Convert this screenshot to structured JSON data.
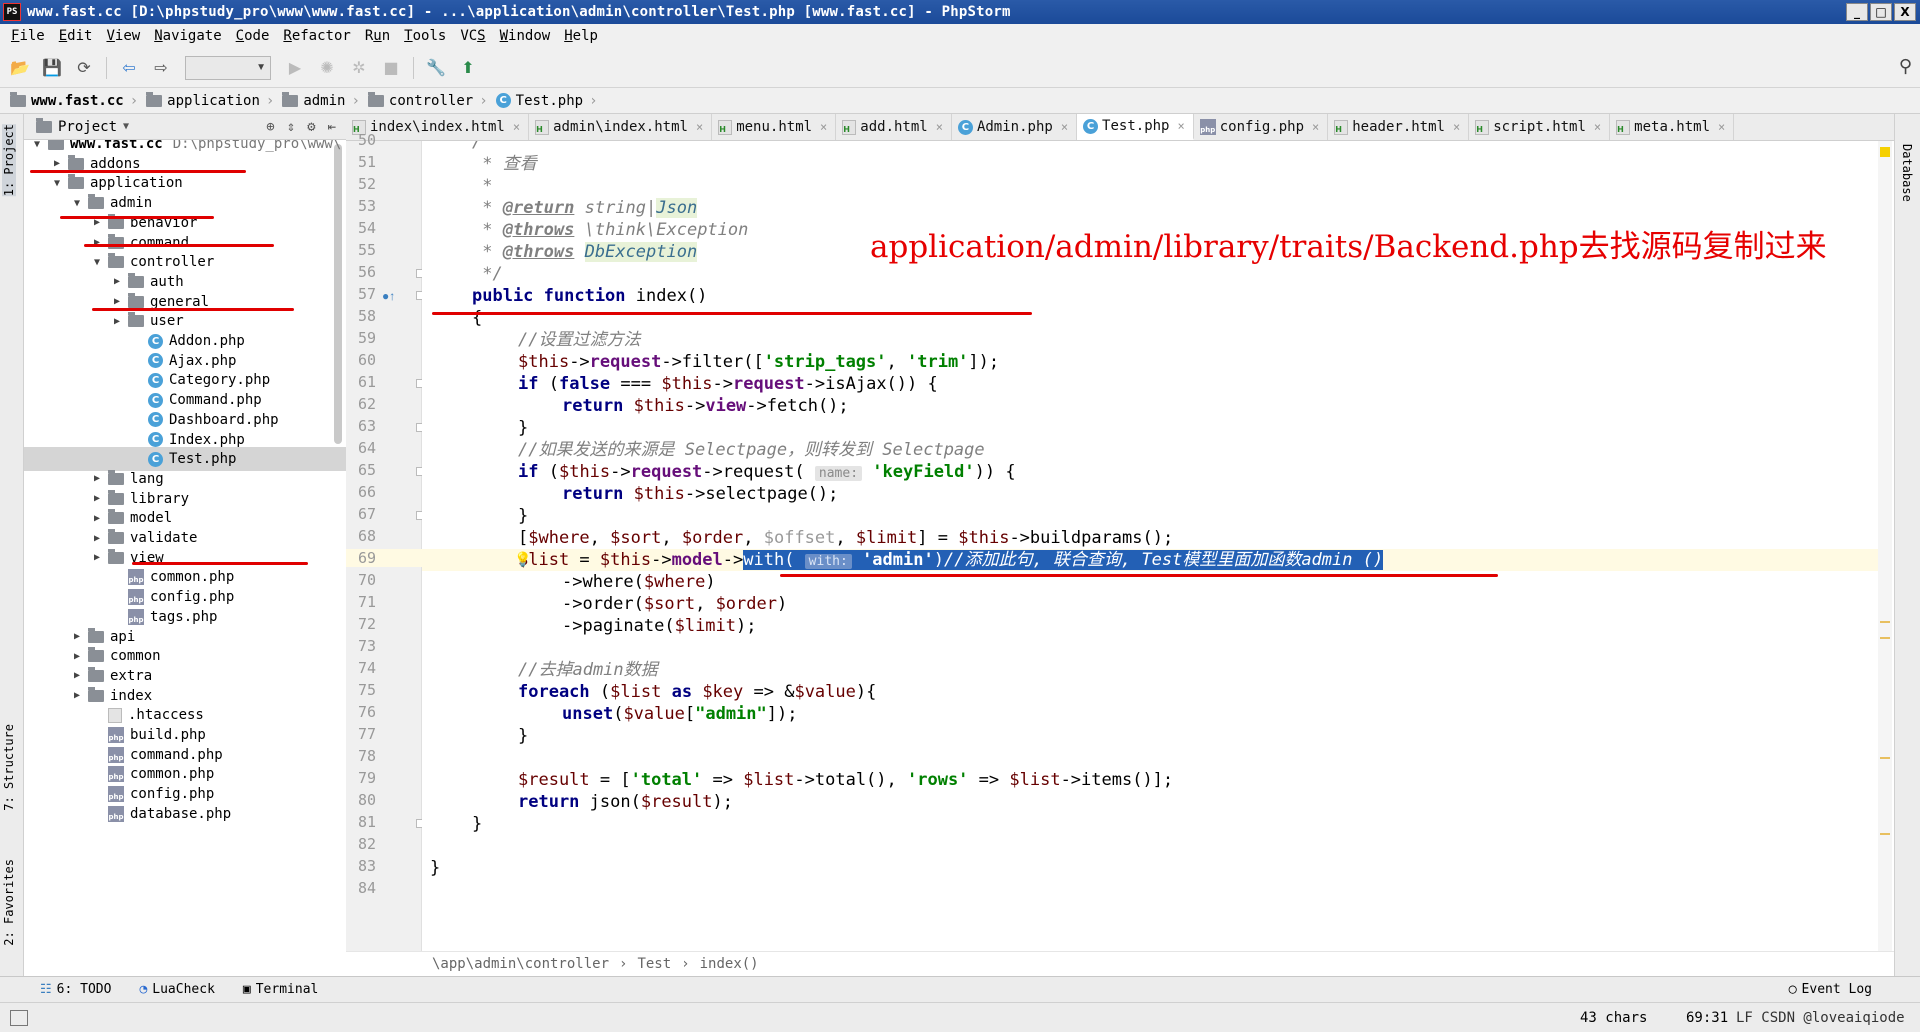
{
  "window": {
    "title": "www.fast.cc [D:\\phpstudy_pro\\www\\www.fast.cc] - ...\\application\\admin\\controller\\Test.php [www.fast.cc] - PhpStorm",
    "app_icon": "PS",
    "buttons": {
      "minimize": "_",
      "maximize": "□",
      "close": "X"
    }
  },
  "menu": [
    {
      "u": "F",
      "rest": "ile"
    },
    {
      "u": "E",
      "rest": "dit"
    },
    {
      "u": "V",
      "rest": "iew"
    },
    {
      "u": "N",
      "rest": "avigate"
    },
    {
      "u": "C",
      "rest": "ode"
    },
    {
      "u": "R",
      "rest": "efactor"
    },
    {
      "u": "",
      "pre": "R",
      "u2": "u",
      "rest": "n"
    },
    {
      "u": "T",
      "rest": "ools"
    },
    {
      "u": "",
      "pre": "VC",
      "u2": "S",
      "rest": ""
    },
    {
      "u": "W",
      "rest": "indow"
    },
    {
      "u": "H",
      "rest": "elp"
    }
  ],
  "breadcrumb": [
    "www.fast.cc",
    "application",
    "admin",
    "controller",
    "Test.php"
  ],
  "project": {
    "header": "Project",
    "tree": [
      {
        "label": "www.fast.cc",
        "path": "D:\\phpstudy_pro\\www\\",
        "type": "folder",
        "depth": 0,
        "open": true,
        "bold": true
      },
      {
        "label": "addons",
        "type": "folder",
        "depth": 1,
        "open": false
      },
      {
        "label": "application",
        "type": "folder",
        "depth": 1,
        "open": true
      },
      {
        "label": "admin",
        "type": "folder",
        "depth": 2,
        "open": true
      },
      {
        "label": "behavior",
        "type": "folder",
        "depth": 3,
        "open": false
      },
      {
        "label": "command",
        "type": "folder",
        "depth": 3,
        "open": false
      },
      {
        "label": "controller",
        "type": "folder",
        "depth": 3,
        "open": true
      },
      {
        "label": "auth",
        "type": "folder",
        "depth": 4,
        "open": false
      },
      {
        "label": "general",
        "type": "folder",
        "depth": 4,
        "open": false
      },
      {
        "label": "user",
        "type": "folder",
        "depth": 4,
        "open": false
      },
      {
        "label": "Addon.php",
        "type": "class",
        "depth": 5
      },
      {
        "label": "Ajax.php",
        "type": "class",
        "depth": 5
      },
      {
        "label": "Category.php",
        "type": "class",
        "depth": 5
      },
      {
        "label": "Command.php",
        "type": "class",
        "depth": 5
      },
      {
        "label": "Dashboard.php",
        "type": "class",
        "depth": 5
      },
      {
        "label": "Index.php",
        "type": "class",
        "depth": 5
      },
      {
        "label": "Test.php",
        "type": "class",
        "depth": 5,
        "selected": true
      },
      {
        "label": "lang",
        "type": "folder",
        "depth": 3,
        "open": false
      },
      {
        "label": "library",
        "type": "folder",
        "depth": 3,
        "open": false
      },
      {
        "label": "model",
        "type": "folder",
        "depth": 3,
        "open": false
      },
      {
        "label": "validate",
        "type": "folder",
        "depth": 3,
        "open": false
      },
      {
        "label": "view",
        "type": "folder",
        "depth": 3,
        "open": false
      },
      {
        "label": "common.php",
        "type": "php",
        "depth": 4
      },
      {
        "label": "config.php",
        "type": "php",
        "depth": 4
      },
      {
        "label": "tags.php",
        "type": "php",
        "depth": 4
      },
      {
        "label": "api",
        "type": "folder",
        "depth": 2,
        "open": false
      },
      {
        "label": "common",
        "type": "folder",
        "depth": 2,
        "open": false
      },
      {
        "label": "extra",
        "type": "folder",
        "depth": 2,
        "open": false
      },
      {
        "label": "index",
        "type": "folder",
        "depth": 2,
        "open": false
      },
      {
        "label": ".htaccess",
        "type": "file",
        "depth": 3
      },
      {
        "label": "build.php",
        "type": "php",
        "depth": 3
      },
      {
        "label": "command.php",
        "type": "php",
        "depth": 3
      },
      {
        "label": "common.php",
        "type": "php",
        "depth": 3
      },
      {
        "label": "config.php",
        "type": "php",
        "depth": 3
      },
      {
        "label": "database.php",
        "type": "php",
        "depth": 3
      }
    ]
  },
  "tabs": [
    {
      "label": "index\\index.html",
      "icon": "html"
    },
    {
      "label": "admin\\index.html",
      "icon": "html"
    },
    {
      "label": "menu.html",
      "icon": "html"
    },
    {
      "label": "add.html",
      "icon": "html"
    },
    {
      "label": "Admin.php",
      "icon": "class"
    },
    {
      "label": "Test.php",
      "icon": "class",
      "active": true
    },
    {
      "label": "config.php",
      "icon": "php"
    },
    {
      "label": "header.html",
      "icon": "html"
    },
    {
      "label": "script.html",
      "icon": "html"
    },
    {
      "label": "meta.html",
      "icon": "html"
    }
  ],
  "left_tools": [
    "1: Project",
    "7: Structure",
    "2: Favorites"
  ],
  "right_tools": [
    "Database"
  ],
  "code": {
    "line_numbers": [
      50,
      51,
      52,
      53,
      54,
      55,
      56,
      57,
      58,
      59,
      60,
      61,
      62,
      63,
      64,
      65,
      66,
      67,
      68,
      69,
      70,
      71,
      72,
      73,
      74,
      75,
      76,
      77,
      78,
      79,
      80,
      81,
      82,
      83,
      84
    ],
    "current_line": 69
  },
  "annotation": {
    "text": "application/admin/library/traits/Backend.php去找源码复制过来"
  },
  "editor_breadcrumb": [
    "\\app\\admin\\controller",
    "Test",
    "index()"
  ],
  "bottom_tools": [
    "6: TODO",
    "LuaCheck",
    "Terminal"
  ],
  "event_log": "Event Log",
  "status": {
    "chars": "43 chars",
    "position": "69:31",
    "misc": "LF  CSDN @loveaiqiode"
  }
}
